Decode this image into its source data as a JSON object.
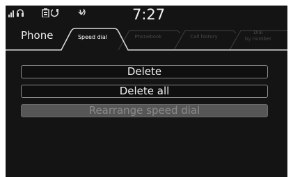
{
  "status_bar": {
    "icons": [
      "signal-strength-icon",
      "headset-icon",
      "battery-icon",
      "handset-icon",
      "bluetooth-phone-icon"
    ],
    "time": "7:27"
  },
  "header": {
    "title": "Phone"
  },
  "tabs": [
    {
      "label": "Speed dial",
      "active": true
    },
    {
      "label": "Phonebook",
      "active": false
    },
    {
      "label": "Call history",
      "active": false
    },
    {
      "label_line1": "Dial",
      "label_line2": "by number",
      "active": false
    }
  ],
  "menu": {
    "delete_label": "Delete",
    "delete_all_label": "Delete all",
    "rearrange_label": "Rearrange speed dial",
    "rearrange_enabled": false
  },
  "colors": {
    "screen_background": "#141414",
    "button_border": "#8a8a8a",
    "disabled_button_fill": "#565656",
    "inactive_tab_text": "#4a4a4a"
  }
}
